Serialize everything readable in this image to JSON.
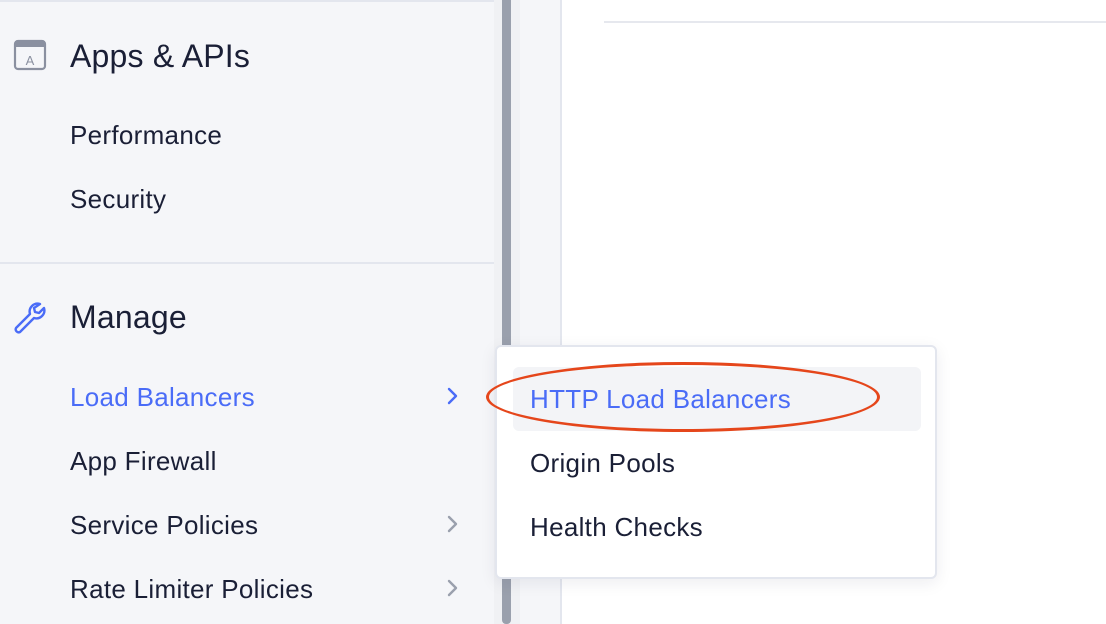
{
  "sidebar": {
    "sections": [
      {
        "title": "Apps & APIs",
        "icon": "app-icon",
        "icon_letter": "A",
        "items": [
          {
            "label": "Performance",
            "has_submenu": false
          },
          {
            "label": "Security",
            "has_submenu": false
          }
        ]
      },
      {
        "title": "Manage",
        "icon": "wrench-icon",
        "items": [
          {
            "label": "Load Balancers",
            "has_submenu": true,
            "active": true
          },
          {
            "label": "App Firewall",
            "has_submenu": false
          },
          {
            "label": "Service Policies",
            "has_submenu": true
          },
          {
            "label": "Rate Limiter Policies",
            "has_submenu": true
          }
        ]
      }
    ]
  },
  "submenu": {
    "items": [
      {
        "label": "HTTP Load Balancers",
        "highlighted": true
      },
      {
        "label": "Origin Pools"
      },
      {
        "label": "Health Checks"
      }
    ]
  },
  "annotation": {
    "shape": "ellipse",
    "color": "#e5461b",
    "target": "HTTP Load Balancers"
  },
  "colors": {
    "accent": "#4a6cf7",
    "text": "#1a1f36",
    "sidebar_bg": "#f5f6f9",
    "annotation": "#e5461b"
  }
}
